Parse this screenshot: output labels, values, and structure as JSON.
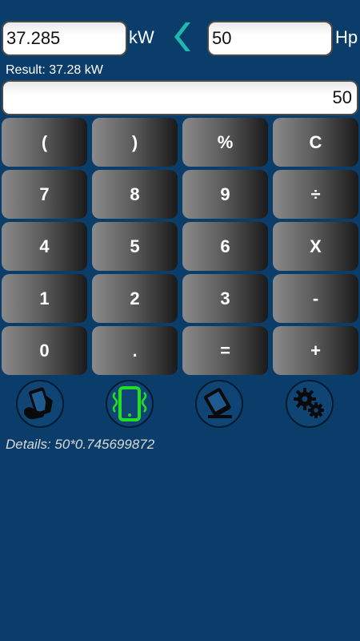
{
  "converter": {
    "from_value": "37.285",
    "from_unit": "kW",
    "to_value": "50",
    "to_unit": "Hp"
  },
  "result_text": "Result: 37.28 kW",
  "display_value": "50",
  "keys": [
    "(",
    ")",
    "%",
    "C",
    "7",
    "8",
    "9",
    "÷",
    "4",
    "5",
    "6",
    "X",
    "1",
    "2",
    "3",
    "-",
    "0",
    ".",
    "=",
    "+"
  ],
  "tools": {
    "icons": [
      "hand-phone-icon",
      "vibrate-phone-icon",
      "eraser-icon",
      "settings-gears-icon"
    ],
    "vibrate_active_color": "#22dd22"
  },
  "details_text": "Details: 50*0.745699872",
  "colors": {
    "background": "#0b3d6a",
    "swap_arrow": "#1fb8b0"
  }
}
